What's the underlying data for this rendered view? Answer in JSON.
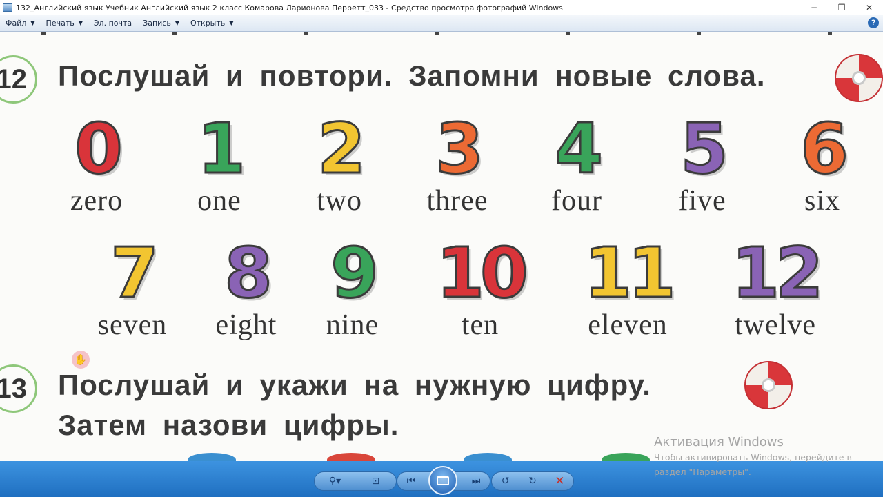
{
  "window": {
    "title": "132_Английский язык Учебник Английский язык 2 класс Комарова Ларионова Перретт_033 - Средство просмотра фотографий Windows",
    "minimize": "−",
    "maximize": "❐",
    "close": "✕"
  },
  "menu": {
    "items": [
      {
        "label": "Файл",
        "dropdown": true
      },
      {
        "label": "Печать",
        "dropdown": true
      },
      {
        "label": "Эл. почта",
        "dropdown": false
      },
      {
        "label": "Запись",
        "dropdown": true
      },
      {
        "label": "Открыть",
        "dropdown": true
      }
    ],
    "help": "?"
  },
  "page": {
    "exercise12": {
      "number": "12",
      "instruction": "Послушай и повтори. Запомни новые слова.",
      "row1": [
        {
          "digit": "0",
          "word": "zero",
          "color": "#d9343a"
        },
        {
          "digit": "1",
          "word": "one",
          "color": "#39a45a"
        },
        {
          "digit": "2",
          "word": "two",
          "color": "#f2c531"
        },
        {
          "digit": "3",
          "word": "three",
          "color": "#ec6a34"
        },
        {
          "digit": "4",
          "word": "four",
          "color": "#39a45a"
        },
        {
          "digit": "5",
          "word": "five",
          "color": "#8a63b5"
        },
        {
          "digit": "6",
          "word": "six",
          "color": "#ec6a34"
        }
      ],
      "row2": [
        {
          "digit": "7",
          "word": "seven",
          "color": "#f2c531"
        },
        {
          "digit": "8",
          "word": "eight",
          "color": "#8a63b5"
        },
        {
          "digit": "9",
          "word": "nine",
          "color": "#39a45a"
        },
        {
          "digit": "10",
          "word": "ten",
          "color": "#d9343a"
        },
        {
          "digit": "11",
          "word": "eleven",
          "color": "#f2c531"
        },
        {
          "digit": "12",
          "word": "twelve",
          "color": "#8a63b5"
        }
      ]
    },
    "exercise13": {
      "number": "13",
      "instruction_line1": "Послушай и укажи на нужную цифру.",
      "instruction_line2": "Затем назови цифры."
    }
  },
  "activation": {
    "title": "Активация Windows",
    "line1": "Чтобы активировать Windows, перейдите в",
    "line2": "раздел \"Параметры\"."
  },
  "controls": {
    "zoom_icon": "magnifier-icon",
    "fit_icon": "fit-window-icon",
    "prev_icon": "previous-icon",
    "slideshow_icon": "slideshow-icon",
    "next_icon": "next-icon",
    "rotate_ccw_icon": "rotate-counterclockwise-icon",
    "rotate_cw_icon": "rotate-clockwise-icon",
    "delete_icon": "delete-icon"
  },
  "colors": {
    "accent": "#1f6fc0",
    "exercise_circle": "#8ec77a",
    "disc_red": "#d9363a"
  }
}
